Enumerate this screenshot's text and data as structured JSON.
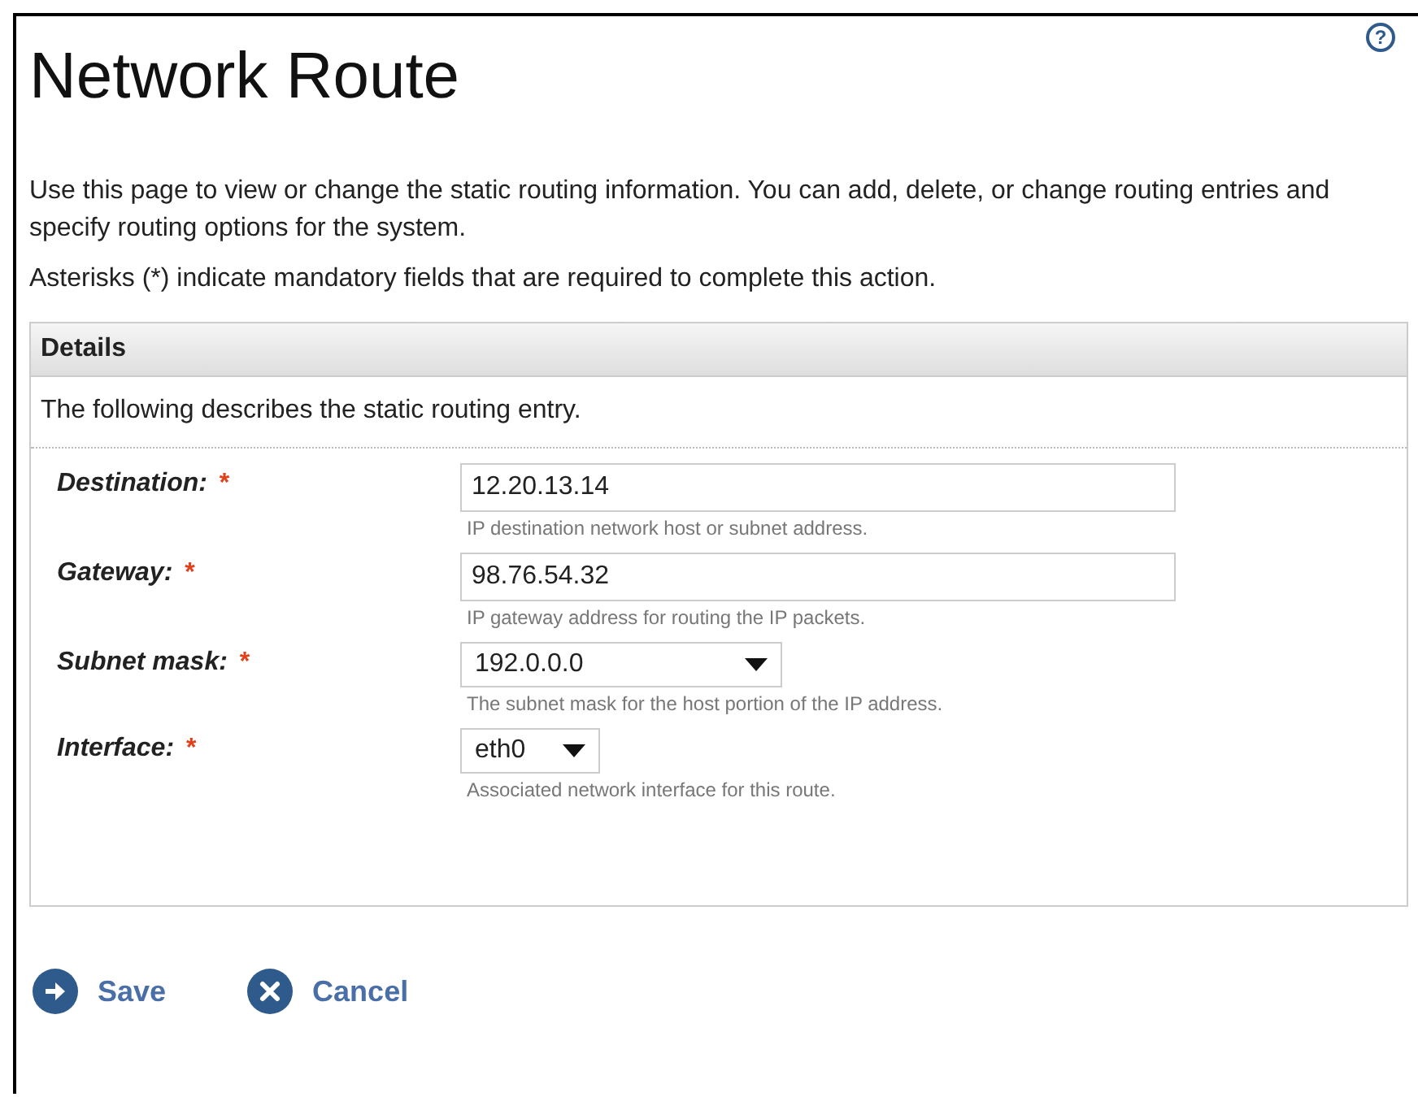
{
  "title": "Network Route",
  "help_icon": "?",
  "intro": "Use this page to view or change the static routing information. You can add, delete, or change routing entries and specify routing options for the system.",
  "mandatory_note": "Asterisks (*) indicate mandatory fields that are required to complete this action.",
  "details": {
    "heading": "Details",
    "description": "The following describes the static routing entry.",
    "fields": [
      {
        "kind": "text",
        "label": "Destination:",
        "required_mark": "*",
        "value": "12.20.13.14",
        "hint": "IP destination network host or subnet address."
      },
      {
        "kind": "text",
        "label": "Gateway:",
        "required_mark": "*",
        "value": "98.76.54.32",
        "hint": "IP gateway address for routing the IP packets."
      },
      {
        "kind": "select",
        "label": "Subnet mask:",
        "required_mark": "*",
        "value": "192.0.0.0",
        "hint": "The subnet mask for the host portion of the IP address."
      },
      {
        "kind": "select_small",
        "label": "Interface:",
        "required_mark": "*",
        "value": "eth0",
        "hint": "Associated network interface for this route."
      }
    ]
  },
  "buttons": [
    {
      "kind": "save",
      "label": "Save"
    },
    {
      "kind": "cancel",
      "label": "Cancel"
    }
  ]
}
